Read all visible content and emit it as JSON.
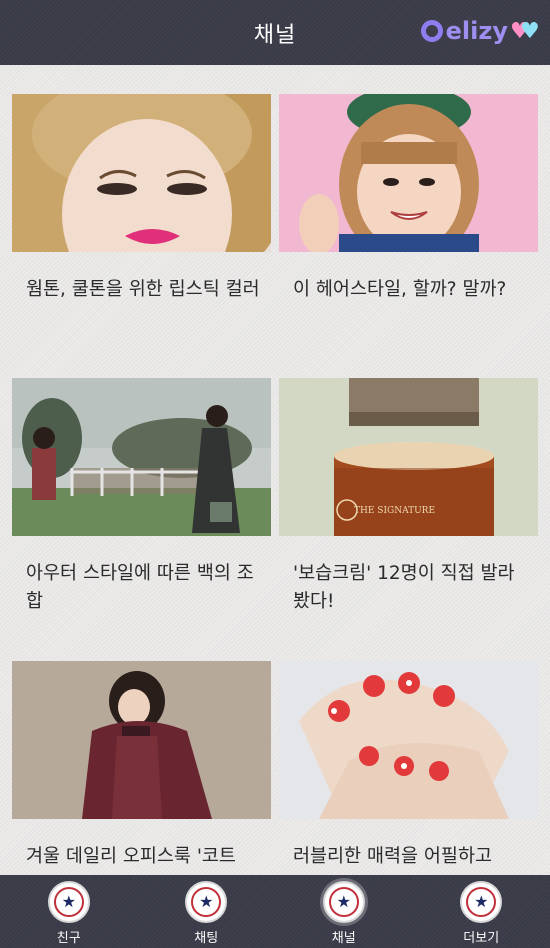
{
  "header": {
    "title": "채널",
    "logo_text": "elizy"
  },
  "cards": [
    {
      "title": "웜톤, 쿨톤을 위한 립스틱 컬러",
      "image": "model with short blond bob and pink lipstick"
    },
    {
      "title": "이 헤어스타일, 할까? 말까?",
      "image": "smiling woman with bangs and green beret waving"
    },
    {
      "title": "아우터 스타일에 따른 백의 조합",
      "image": "two women outdoors by a fence in coats"
    },
    {
      "title": "'보습크림' 12명이 직접 발라봤다!",
      "image": "open jar of moisturizing cream"
    },
    {
      "title": "겨울 데일리 오피스룩 '코트",
      "image": "woman in burgundy coat"
    },
    {
      "title": "러블리한 매력을 어필하고",
      "image": "hands with red heart nail art"
    }
  ],
  "jar_label": "THE SIGNATURE",
  "tabs": [
    {
      "label": "친구",
      "icon": "all-star-badge-icon",
      "active": false
    },
    {
      "label": "채팅",
      "icon": "all-star-badge-icon",
      "active": false
    },
    {
      "label": "채널",
      "icon": "all-star-badge-icon",
      "active": true
    },
    {
      "label": "더보기",
      "icon": "all-star-badge-icon",
      "active": false
    }
  ],
  "colors": {
    "bar": "#3a3b48",
    "background": "#ecebea",
    "logo": "#9d8ef0"
  }
}
